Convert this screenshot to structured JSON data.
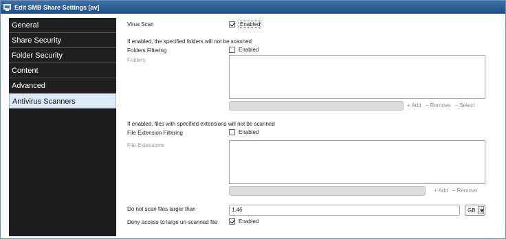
{
  "window": {
    "title": "Edit SMB Share Settings [av]"
  },
  "sidebar": {
    "items": [
      {
        "label": "General"
      },
      {
        "label": "Share Security"
      },
      {
        "label": "Folder Security"
      },
      {
        "label": "Content"
      },
      {
        "label": "Advanced"
      },
      {
        "label": "Antivirus Scanners"
      }
    ],
    "active_index": 5
  },
  "form": {
    "virus_scan": {
      "label": "Virus Scan",
      "checkbox_label": "Enabled",
      "checked": true
    },
    "folders_note": "If enabled, the specified folders will not be scanned",
    "folders_filtering": {
      "label": "Folders Filtering",
      "checkbox_label": "Enabled",
      "checked": false
    },
    "folders": {
      "label": "Folders",
      "actions": {
        "add": "+ Add",
        "remove": "− Remove",
        "select": "− Select"
      }
    },
    "ext_note": "If enabled, files with specified extensions will not be scanned",
    "ext_filtering": {
      "label": "File Extension Filtering",
      "checkbox_label": "Enabled",
      "checked": false
    },
    "extensions": {
      "label": "File Extensions",
      "actions": {
        "add": "+ Add",
        "remove": "− Remove"
      }
    },
    "max_size": {
      "label": "Do not scan files larger than",
      "value": "1.46",
      "unit": "GB"
    },
    "deny_access": {
      "label": "Deny access to large un-scanned file",
      "checkbox_label": "Enabled",
      "checked": true
    }
  }
}
